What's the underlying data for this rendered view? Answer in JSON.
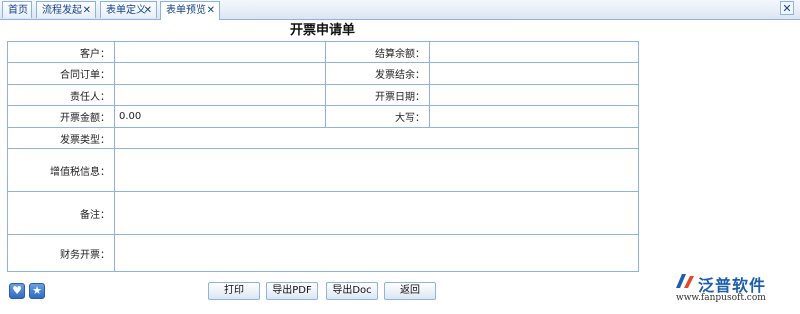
{
  "tabs": [
    {
      "label": "首页",
      "closable": false
    },
    {
      "label": "流程发起",
      "closable": true
    },
    {
      "label": "表单定义",
      "closable": true
    },
    {
      "label": "表单预览",
      "closable": true,
      "active": true
    }
  ],
  "form": {
    "title": "开票申请单",
    "rows": {
      "customer_label": "客户：",
      "balance_label": "结算余额：",
      "contract_label": "合同订单：",
      "invoice_remain_label": "发票结余：",
      "owner_label": "责任人：",
      "invoice_date_label": "开票日期：",
      "amount_label": "开票金额：",
      "amount_value": "0.00",
      "uppercase_label": "大写：",
      "invoice_type_label": "发票类型：",
      "vat_label": "增值税信息：",
      "remark_label": "备注：",
      "finance_label": "财务开票："
    }
  },
  "buttons": {
    "print": "打印",
    "export_pdf": "导出PDF",
    "export_doc": "导出Doc",
    "back": "返回"
  },
  "logo": {
    "name": "泛普软件",
    "url": "www.fanpusoft.com"
  },
  "colors": {
    "border": "#8db2e3",
    "accent": "#1d5fae"
  }
}
